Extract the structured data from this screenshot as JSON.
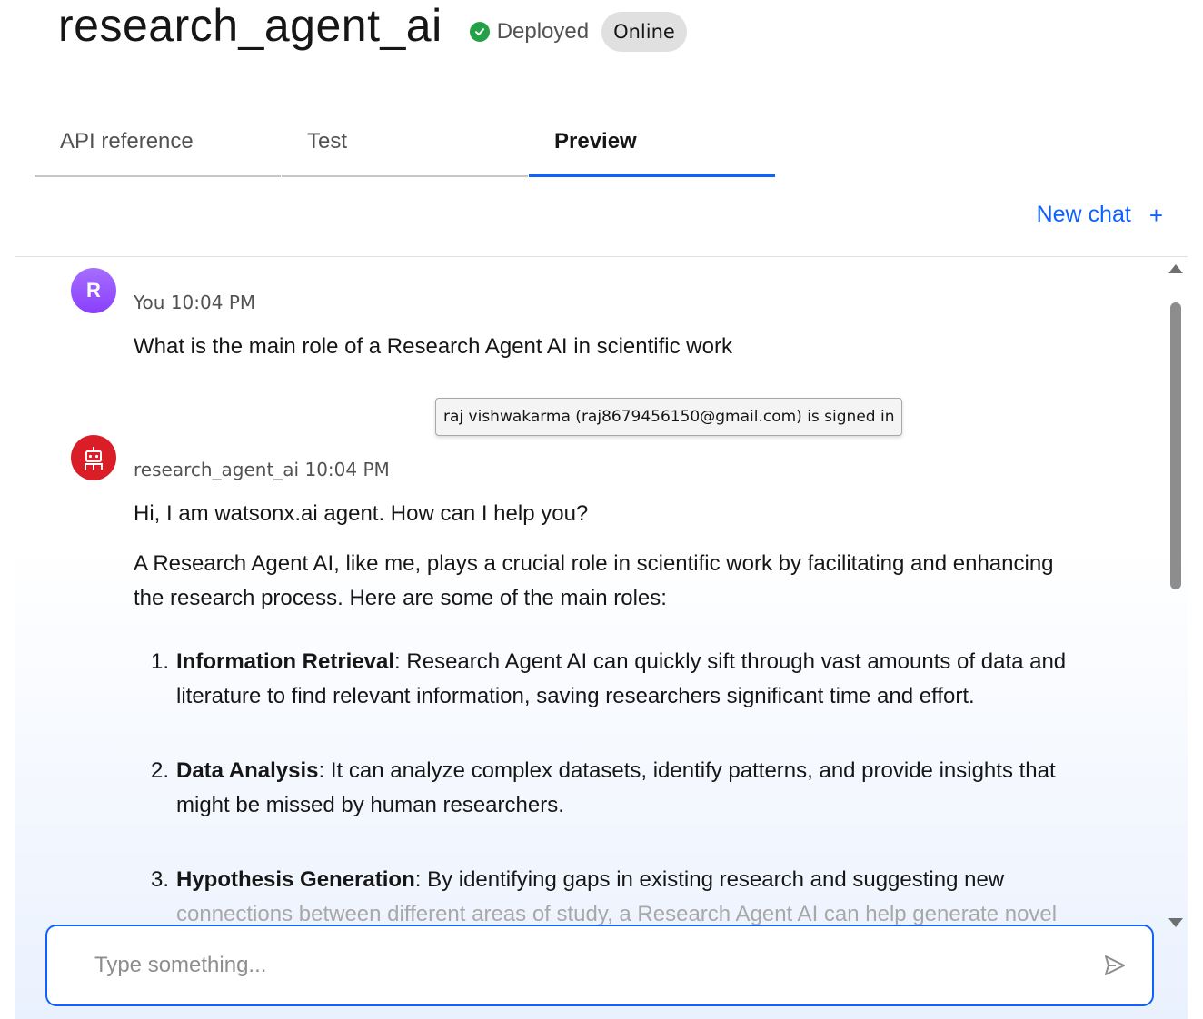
{
  "header": {
    "title": "research_agent_ai",
    "status_label": "Deployed",
    "status_color": "#24a148",
    "badge_label": "Online"
  },
  "tabs": [
    {
      "label": "API reference",
      "active": false
    },
    {
      "label": "Test",
      "active": false
    },
    {
      "label": "Preview",
      "active": true
    }
  ],
  "accent_color": "#0f62fe",
  "new_chat": {
    "label": "New chat",
    "icon": "plus-icon"
  },
  "messages": {
    "user": {
      "avatar_letter": "R",
      "meta": "You 10:04 PM",
      "text": "What is the main role of a Research Agent AI in scientific work"
    },
    "tooltip": "raj vishwakarma (raj8679456150@gmail.com) is signed in",
    "agent": {
      "avatar_icon": "robot-icon",
      "meta": "research_agent_ai 10:04 PM",
      "greeting": "Hi, I am watsonx.ai agent. How can I help you?",
      "intro": "A Research Agent AI, like me, plays a crucial role in scientific work by facilitating and enhancing the research process. Here are some of the main roles:",
      "list": [
        {
          "num": "1.",
          "title": "Information Retrieval",
          "text": ": Research Agent AI can quickly sift through vast amounts of data and literature to find relevant information, saving researchers significant time and effort."
        },
        {
          "num": "2.",
          "title": "Data Analysis",
          "text": ": It can analyze complex datasets, identify patterns, and provide insights that might be missed by human researchers."
        },
        {
          "num": "3.",
          "title": "Hypothesis Generation",
          "text": ": By identifying gaps in existing research and suggesting new",
          "text_faded": "connections between different areas of study, a Research Agent AI can help generate novel"
        }
      ]
    }
  },
  "input": {
    "placeholder": "Type something...",
    "value": ""
  }
}
